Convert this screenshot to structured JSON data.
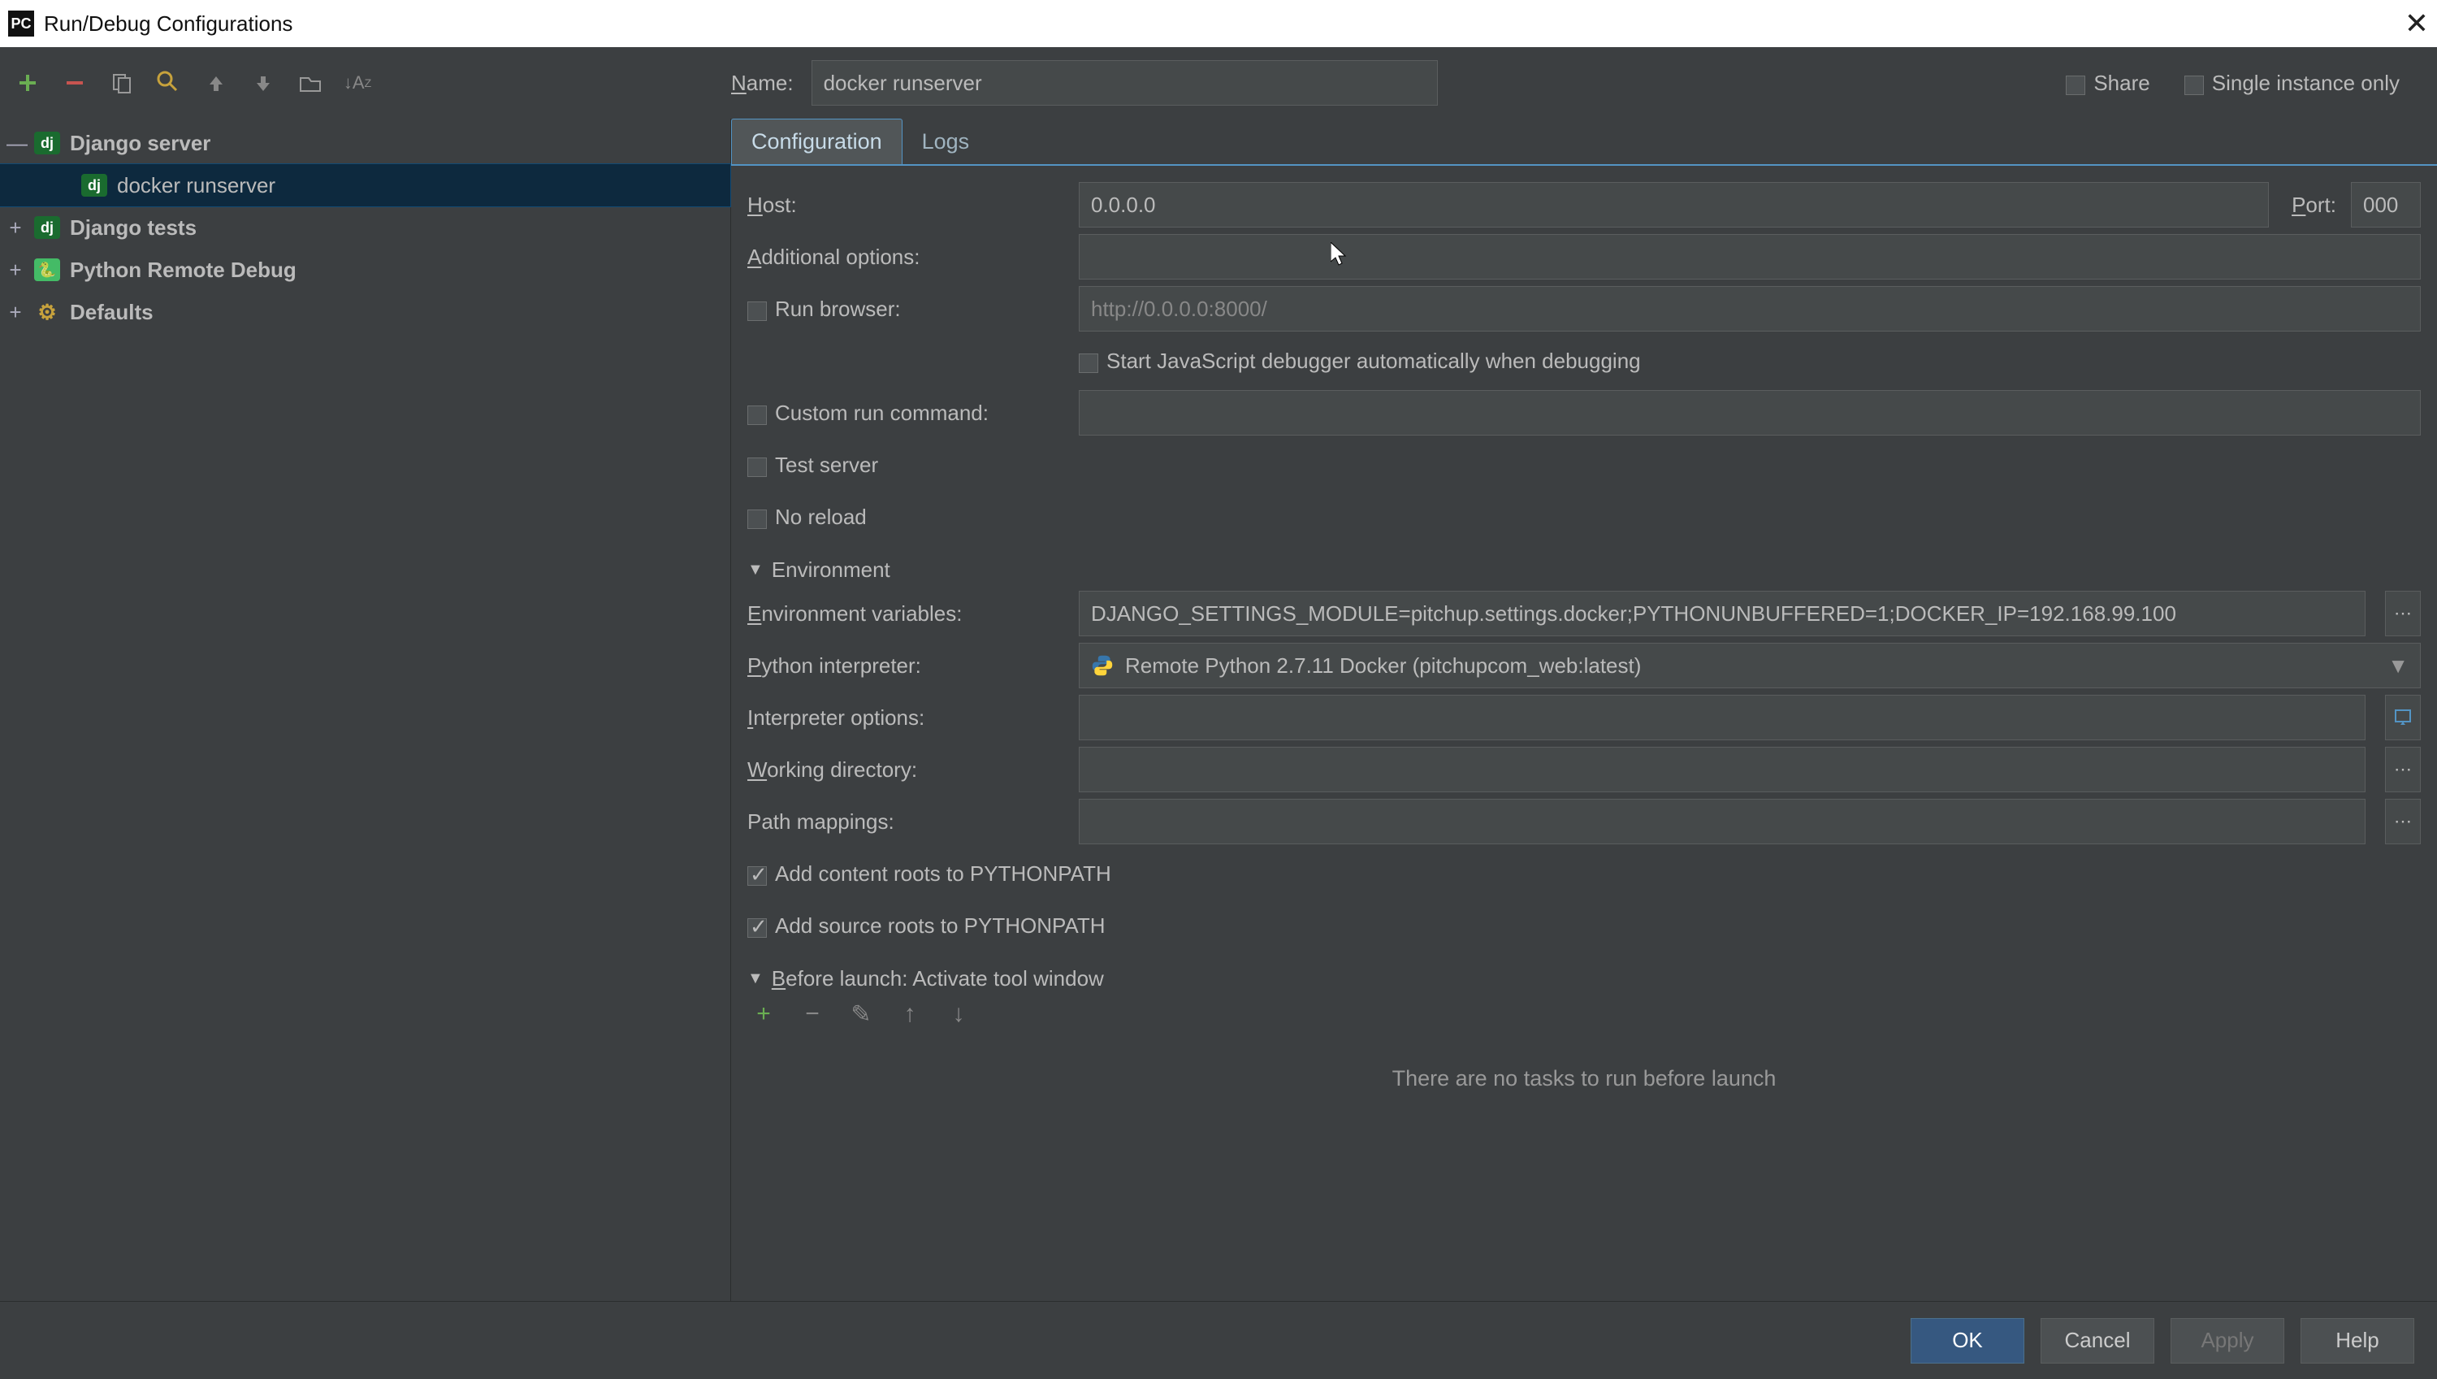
{
  "window_title": "Run/Debug Configurations",
  "toolbar": {
    "share_label": "Share",
    "single_instance_label": "Single instance only"
  },
  "name_field": {
    "label": "Name:",
    "value": "docker runserver"
  },
  "tree": {
    "items": [
      {
        "label": "Django server",
        "badge": "dj",
        "expanded": true,
        "bold": true,
        "children": [
          {
            "label": "docker runserver",
            "badge": "dj",
            "selected": true
          }
        ]
      },
      {
        "label": "Django tests",
        "badge": "dj",
        "expanded": false,
        "bold": true
      },
      {
        "label": "Python Remote Debug",
        "badge": "py",
        "expanded": false,
        "bold": true
      },
      {
        "label": "Defaults",
        "badge": "gear",
        "expanded": false,
        "bold": true
      }
    ]
  },
  "tabs": [
    {
      "label": "Configuration",
      "active": true
    },
    {
      "label": "Logs",
      "active": false
    }
  ],
  "config": {
    "host_label": "Host:",
    "host_value": "0.0.0.0",
    "port_label": "Port:",
    "port_value": "000",
    "additional_options_label": "Additional options:",
    "run_browser_label": "Run browser:",
    "run_browser_value": "http://0.0.0.0:8000/",
    "start_js_debugger_label": "Start JavaScript debugger automatically when debugging",
    "custom_run_label": "Custom run command:",
    "test_server_label": "Test server",
    "no_reload_label": "No reload"
  },
  "environment": {
    "header": "Environment",
    "env_vars_label": "Environment variables:",
    "env_vars_value": "DJANGO_SETTINGS_MODULE=pitchup.settings.docker;PYTHONUNBUFFERED=1;DOCKER_IP=192.168.99.100",
    "py_interp_label": "Python interpreter:",
    "py_interp_value": "Remote Python 2.7.11 Docker (pitchupcom_web:latest)",
    "interp_options_label": "Interpreter options:",
    "working_dir_label": "Working directory:",
    "path_mappings_label": "Path mappings:",
    "add_content_roots_label": "Add content roots to PYTHONPATH",
    "add_source_roots_label": "Add source roots to PYTHONPATH"
  },
  "before_launch": {
    "header": "Before launch: Activate tool window",
    "no_tasks_label": "There are no tasks to run before launch"
  },
  "footer": {
    "ok": "OK",
    "cancel": "Cancel",
    "apply": "Apply",
    "help": "Help"
  }
}
